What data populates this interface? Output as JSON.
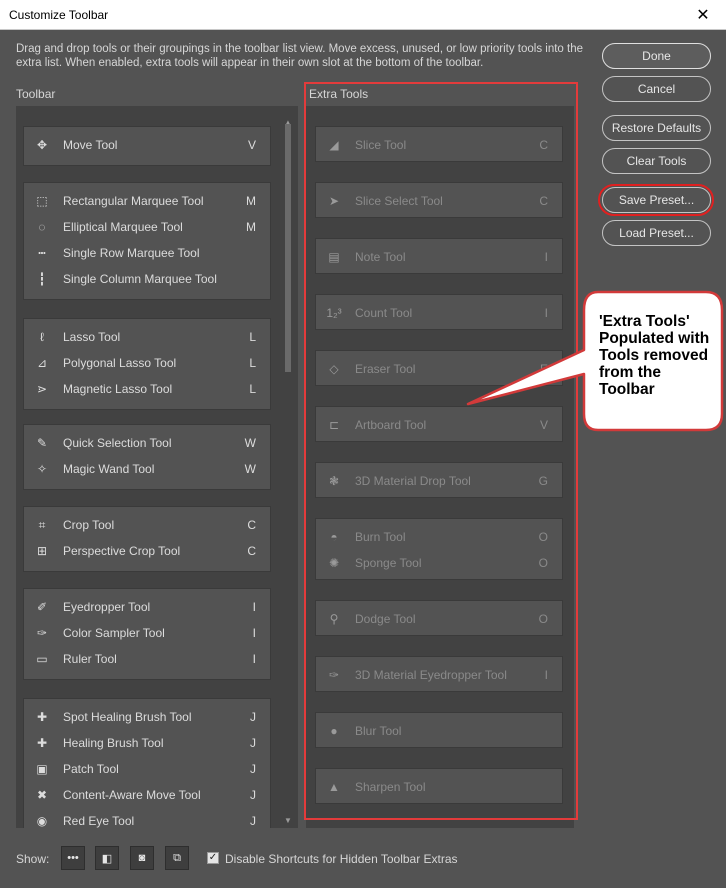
{
  "window": {
    "title": "Customize Toolbar",
    "close_glyph": "✕"
  },
  "description": "Drag and drop tools or their groupings in the toolbar list view. Move excess, unused, or low priority tools into the extra list. When enabled, extra tools will appear in their own slot at the bottom of the toolbar.",
  "headings": {
    "toolbar": "Toolbar",
    "extra": "Extra Tools"
  },
  "toolbar_groups": [
    {
      "tools": [
        {
          "icon": "move-icon",
          "glyph": "✥",
          "label": "Move Tool",
          "key": "V"
        }
      ]
    },
    {
      "tools": [
        {
          "icon": "rectangular-marquee-icon",
          "glyph": "⬚",
          "label": "Rectangular Marquee Tool",
          "key": "M"
        },
        {
          "icon": "elliptical-marquee-icon",
          "glyph": "◌",
          "label": "Elliptical Marquee Tool",
          "key": "M"
        },
        {
          "icon": "single-row-marquee-icon",
          "glyph": "┅",
          "label": "Single Row Marquee Tool",
          "key": ""
        },
        {
          "icon": "single-column-marquee-icon",
          "glyph": "┇",
          "label": "Single Column Marquee Tool",
          "key": ""
        }
      ]
    },
    {
      "tools": [
        {
          "icon": "lasso-icon",
          "glyph": "ℓ",
          "label": "Lasso Tool",
          "key": "L"
        },
        {
          "icon": "polygonal-lasso-icon",
          "glyph": "⊿",
          "label": "Polygonal Lasso Tool",
          "key": "L"
        },
        {
          "icon": "magnetic-lasso-icon",
          "glyph": "⋗",
          "label": "Magnetic Lasso Tool",
          "key": "L"
        }
      ]
    },
    {
      "tools": [
        {
          "icon": "quick-selection-icon",
          "glyph": "✎",
          "label": "Quick Selection Tool",
          "key": "W"
        },
        {
          "icon": "magic-wand-icon",
          "glyph": "✧",
          "label": "Magic Wand Tool",
          "key": "W"
        }
      ]
    },
    {
      "tools": [
        {
          "icon": "crop-icon",
          "glyph": "⌗",
          "label": "Crop Tool",
          "key": "C"
        },
        {
          "icon": "perspective-crop-icon",
          "glyph": "⊞",
          "label": "Perspective Crop Tool",
          "key": "C"
        }
      ]
    },
    {
      "tools": [
        {
          "icon": "eyedropper-icon",
          "glyph": "✐",
          "label": "Eyedropper Tool",
          "key": "I"
        },
        {
          "icon": "color-sampler-icon",
          "glyph": "✑",
          "label": "Color Sampler Tool",
          "key": "I"
        },
        {
          "icon": "ruler-icon",
          "glyph": "▭",
          "label": "Ruler Tool",
          "key": "I"
        }
      ]
    },
    {
      "tools": [
        {
          "icon": "spot-healing-brush-icon",
          "glyph": "✚",
          "label": "Spot Healing Brush Tool",
          "key": "J"
        },
        {
          "icon": "healing-brush-icon",
          "glyph": "✚",
          "label": "Healing Brush Tool",
          "key": "J"
        },
        {
          "icon": "patch-icon",
          "glyph": "▣",
          "label": "Patch Tool",
          "key": "J"
        },
        {
          "icon": "content-aware-move-icon",
          "glyph": "✖",
          "label": "Content-Aware Move Tool",
          "key": "J"
        },
        {
          "icon": "red-eye-icon",
          "glyph": "◉",
          "label": "Red Eye Tool",
          "key": "J"
        }
      ]
    }
  ],
  "extra_groups": [
    {
      "tools": [
        {
          "icon": "slice-icon",
          "glyph": "◢",
          "label": "Slice Tool",
          "key": "C"
        }
      ]
    },
    {
      "tools": [
        {
          "icon": "slice-select-icon",
          "glyph": "➤",
          "label": "Slice Select Tool",
          "key": "C"
        }
      ]
    },
    {
      "tools": [
        {
          "icon": "note-icon",
          "glyph": "▤",
          "label": "Note Tool",
          "key": "I"
        }
      ]
    },
    {
      "tools": [
        {
          "icon": "count-icon",
          "glyph": "1₂³",
          "label": "Count Tool",
          "key": "I"
        }
      ]
    },
    {
      "tools": [
        {
          "icon": "eraser-icon",
          "glyph": "◇",
          "label": "Eraser Tool",
          "key": "E"
        }
      ]
    },
    {
      "tools": [
        {
          "icon": "artboard-icon",
          "glyph": "⊏",
          "label": "Artboard Tool",
          "key": "V"
        }
      ]
    },
    {
      "tools": [
        {
          "icon": "3d-material-drop-icon",
          "glyph": "❃",
          "label": "3D Material Drop Tool",
          "key": "G"
        }
      ]
    },
    {
      "tools": [
        {
          "icon": "burn-icon",
          "glyph": "◓",
          "label": "Burn Tool",
          "key": "O"
        },
        {
          "icon": "sponge-icon",
          "glyph": "✺",
          "label": "Sponge Tool",
          "key": "O"
        }
      ]
    },
    {
      "tools": [
        {
          "icon": "dodge-icon",
          "glyph": "⚲",
          "label": "Dodge Tool",
          "key": "O"
        }
      ]
    },
    {
      "tools": [
        {
          "icon": "3d-material-eyedropper-icon",
          "glyph": "✑",
          "label": "3D Material Eyedropper Tool",
          "key": "I"
        }
      ]
    },
    {
      "tools": [
        {
          "icon": "blur-icon",
          "glyph": "●",
          "label": "Blur Tool",
          "key": ""
        }
      ]
    },
    {
      "tools": [
        {
          "icon": "sharpen-icon",
          "glyph": "▲",
          "label": "Sharpen Tool",
          "key": ""
        }
      ]
    }
  ],
  "buttons": {
    "done": "Done",
    "cancel": "Cancel",
    "restore_defaults": "Restore Defaults",
    "clear_tools": "Clear Tools",
    "save_preset": "Save Preset...",
    "load_preset": "Load Preset..."
  },
  "callout": {
    "text": "'Extra Tools' Populated with Tools removed from the Toolbar"
  },
  "bottom": {
    "show_label": "Show:",
    "show_icons": [
      {
        "name": "more-icon",
        "glyph": "•••"
      },
      {
        "name": "swap-colors-icon",
        "glyph": "◧"
      },
      {
        "name": "quick-mask-icon",
        "glyph": "◙"
      },
      {
        "name": "screen-mode-icon",
        "glyph": "⧉"
      }
    ],
    "checkbox_checked": true,
    "checkbox_label": "Disable Shortcuts for Hidden Toolbar Extras"
  },
  "colors": {
    "dialog_bg": "#535353",
    "panel_bg": "#424242",
    "highlight": "#e33b3b"
  }
}
